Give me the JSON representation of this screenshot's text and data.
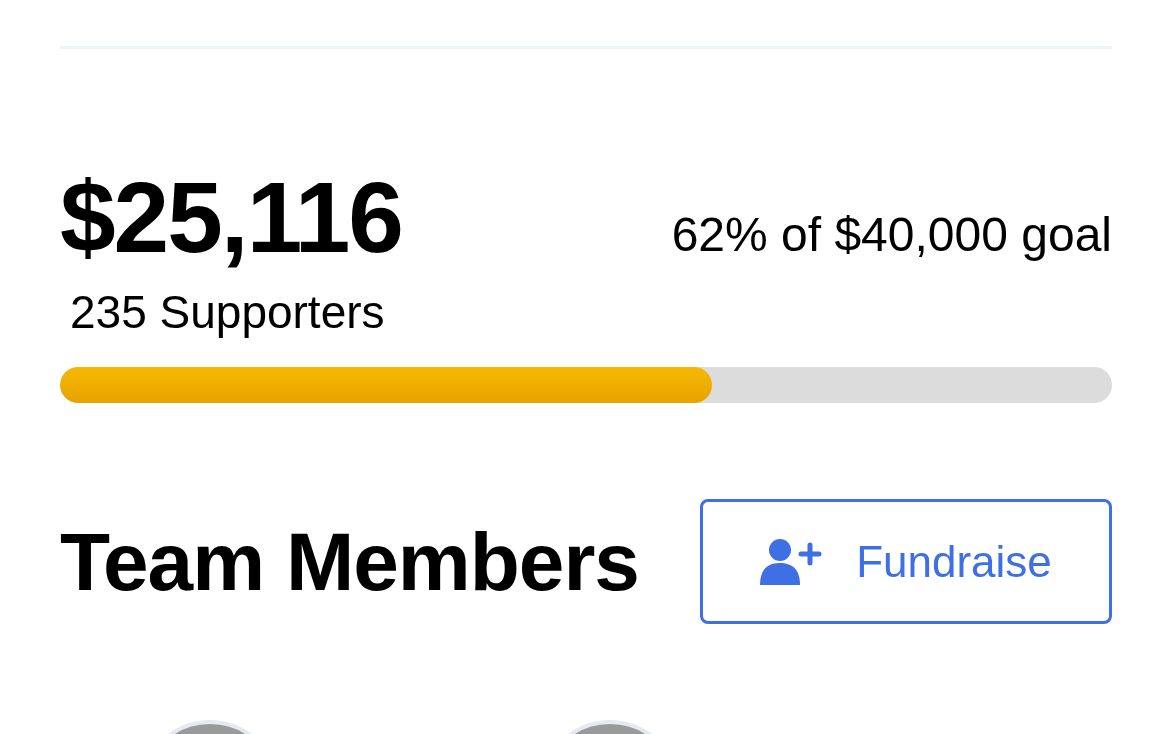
{
  "summary": {
    "amount": "$25,116",
    "goal_text": "62% of $40,000 goal",
    "supporters": "235 Supporters",
    "progress": {
      "level": 0.62
    }
  },
  "team": {
    "title": "Team Members",
    "button": "Fundraise",
    "members": [
      {
        "kind": "avatar"
      },
      {
        "kind": "avatar"
      }
    ]
  }
}
